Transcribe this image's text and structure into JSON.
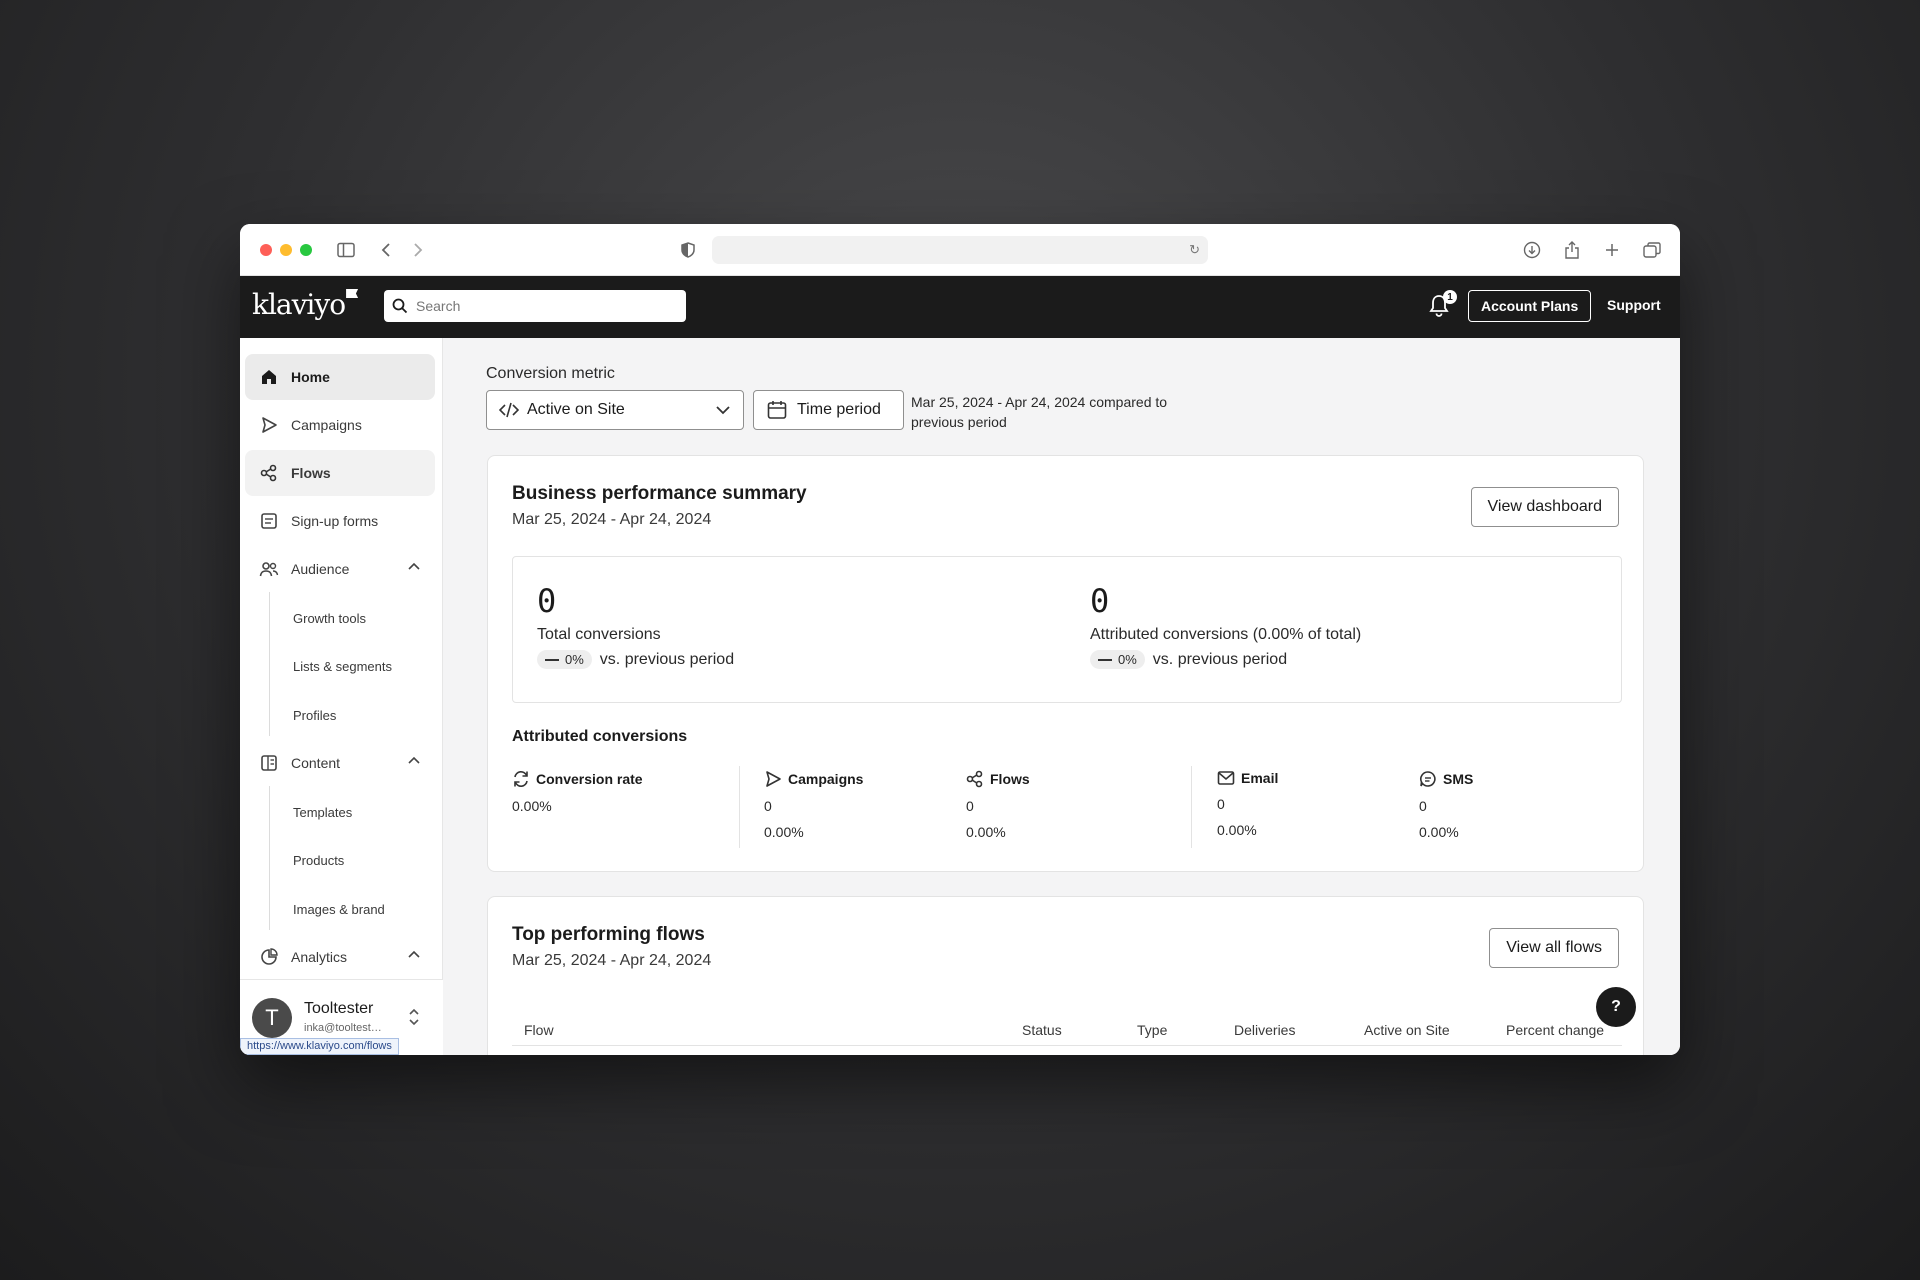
{
  "header": {
    "search_placeholder": "Search",
    "notification_count": "1",
    "account_plans_label": "Account Plans",
    "support_label": "Support"
  },
  "sidebar": {
    "items": [
      {
        "label": "Home",
        "icon": "home-icon"
      },
      {
        "label": "Campaigns",
        "icon": "send-icon"
      },
      {
        "label": "Flows",
        "icon": "flows-icon"
      },
      {
        "label": "Sign-up forms",
        "icon": "form-icon"
      },
      {
        "label": "Audience",
        "icon": "audience-icon"
      },
      {
        "label": "Content",
        "icon": "content-icon"
      },
      {
        "label": "Analytics",
        "icon": "analytics-icon"
      }
    ],
    "audience_sub": [
      "Growth tools",
      "Lists & segments",
      "Profiles"
    ],
    "content_sub": [
      "Templates",
      "Products",
      "Images & brand"
    ],
    "user": {
      "initial": "T",
      "name": "Tooltester",
      "email": "inka@tooltest…"
    },
    "status_url": "https://www.klaviyo.com/flows"
  },
  "main": {
    "conversion_metric_label": "Conversion metric",
    "metric_value": "Active on Site",
    "time_period_label": "Time period",
    "range_note": "Mar 25, 2024 - Apr 24, 2024 compared to previous period",
    "summary": {
      "title": "Business performance summary",
      "date_range": "Mar 25, 2024 - Apr 24, 2024",
      "view_dashboard_label": "View dashboard",
      "kpis": [
        {
          "value": "0",
          "label": "Total conversions",
          "delta": "0%",
          "delta_suffix": "vs. previous period"
        },
        {
          "value": "0",
          "label": "Attributed conversions (0.00% of total)",
          "delta": "0%",
          "delta_suffix": "vs. previous period"
        }
      ],
      "attributed_title": "Attributed conversions",
      "attributed": [
        {
          "label": "Conversion rate",
          "icon": "refresh-icon",
          "value": "0.00%",
          "pct": ""
        },
        {
          "label": "Campaigns",
          "icon": "send-icon",
          "value": "0",
          "pct": "0.00%"
        },
        {
          "label": "Flows",
          "icon": "flows-icon",
          "value": "0",
          "pct": "0.00%"
        },
        {
          "label": "Email",
          "icon": "mail-icon",
          "value": "0",
          "pct": "0.00%"
        },
        {
          "label": "SMS",
          "icon": "sms-icon",
          "value": "0",
          "pct": "0.00%"
        }
      ]
    },
    "flows": {
      "title": "Top performing flows",
      "date_range": "Mar 25, 2024 - Apr 24, 2024",
      "view_all_label": "View all flows",
      "columns": [
        "Flow",
        "Status",
        "Type",
        "Deliveries",
        "Active on Site",
        "Percent change"
      ]
    },
    "help_label": "?"
  }
}
